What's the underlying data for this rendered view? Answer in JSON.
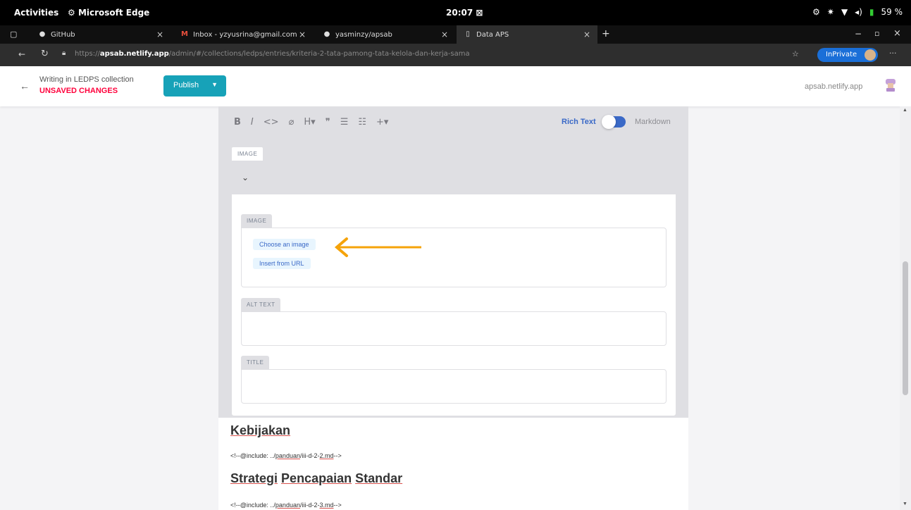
{
  "os_bar": {
    "activities": "Activities",
    "app_name": "Microsoft Edge",
    "clock": "20:07",
    "battery": "59 %"
  },
  "tabs": [
    {
      "label": "GitHub",
      "icon": "github-icon"
    },
    {
      "label": "Inbox - yzyusrina@gmail.com",
      "icon": "gmail-icon"
    },
    {
      "label": "yasminzy/apsab",
      "icon": "github-icon"
    },
    {
      "label": "Data APS",
      "icon": "page-icon",
      "active": true
    }
  ],
  "address": {
    "url_prefix": "https://",
    "url_host": "apsab.netlify.app",
    "url_path": "/admin/#/collections/ledps/entries/kriteria-2-tata-pamong-tata-kelola-dan-kerja-sama",
    "inprivate": "InPrivate"
  },
  "cms_header": {
    "writing_in": "Writing in LEDPS collection",
    "unsaved": "UNSAVED CHANGES",
    "publish": "Publish",
    "site": "apsab.netlify.app"
  },
  "toolbar": {
    "rich_text": "Rich Text",
    "markdown": "Markdown"
  },
  "image_widget": {
    "outer_label": "IMAGE",
    "image_label": "IMAGE",
    "choose_image": "Choose an image",
    "insert_url": "Insert from URL",
    "alt_label": "ALT TEXT",
    "title_label": "TITLE"
  },
  "content": {
    "heading1_a": "Kebijakan",
    "comment1_a": "<!--@include: ../",
    "comment1_b": "panduan",
    "comment1_c": "/iii-d-2-",
    "comment1_d": "2.md",
    "comment1_e": "-->",
    "heading2_a": "Strategi",
    "heading2_b": "Pencapaian",
    "heading2_c": "Standar",
    "comment2_a": "<!--@include: ../",
    "comment2_b": "panduan",
    "comment2_c": "/iii-d-2-",
    "comment2_d": "3.md",
    "comment2_e": "-->"
  },
  "colors": {
    "accent": "#17a2b8",
    "unsaved": "#ff003b",
    "link_blue": "#3a69c7",
    "annotation": "#f5a30a"
  }
}
